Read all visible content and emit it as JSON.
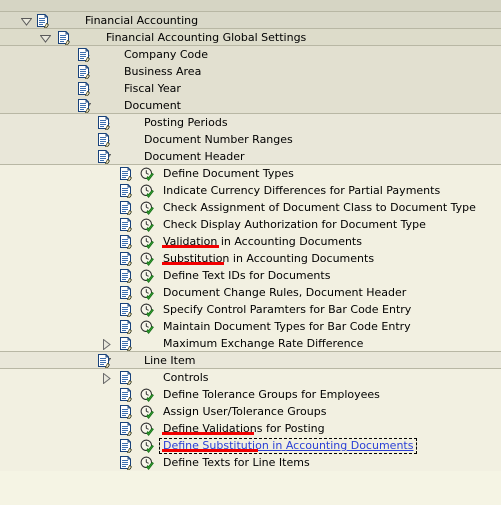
{
  "app": {
    "name": "SAP Implementation Guide (IMG) tree",
    "colors": {
      "background": "#f5f4e4",
      "row_line": "#b8b7a4",
      "link_text": "#2a3fd6",
      "marker_red": "#f20000",
      "text": "#000000"
    }
  },
  "tree": {
    "rows": [
      {
        "id": "financial-accounting",
        "label": "Financial Accounting",
        "level": 0,
        "node_type": "folder",
        "state": "expanded",
        "twisty": "chevron-down-icon",
        "icon": "img-node-icon",
        "has_activity_icon": false,
        "marked": false,
        "focused": false,
        "link": false
      },
      {
        "id": "financial-accounting-global-settings",
        "label": "Financial Accounting Global Settings",
        "level": 1,
        "node_type": "folder",
        "state": "expanded",
        "twisty": "chevron-down-icon",
        "icon": "img-node-icon",
        "has_activity_icon": false,
        "marked": false,
        "focused": false,
        "link": false
      },
      {
        "id": "company-code",
        "label": "Company Code",
        "level": 2,
        "node_type": "folder",
        "state": "collapsed",
        "twisty": "chevron-right-icon",
        "icon": "img-node-icon",
        "has_activity_icon": false,
        "marked": false,
        "focused": false,
        "link": false
      },
      {
        "id": "business-area",
        "label": "Business Area",
        "level": 2,
        "node_type": "folder",
        "state": "collapsed",
        "twisty": "chevron-right-icon",
        "icon": "img-node-icon",
        "has_activity_icon": false,
        "marked": false,
        "focused": false,
        "link": false
      },
      {
        "id": "fiscal-year",
        "label": "Fiscal Year",
        "level": 2,
        "node_type": "folder",
        "state": "collapsed",
        "twisty": "chevron-right-icon",
        "icon": "img-node-icon",
        "has_activity_icon": false,
        "marked": false,
        "focused": false,
        "link": false
      },
      {
        "id": "document",
        "label": "Document",
        "level": 2,
        "node_type": "folder",
        "state": "expanded",
        "twisty": "chevron-down-icon",
        "icon": "img-node-icon",
        "has_activity_icon": false,
        "marked": false,
        "focused": false,
        "link": false
      },
      {
        "id": "posting-periods",
        "label": "Posting Periods",
        "level": 3,
        "node_type": "folder",
        "state": "collapsed",
        "twisty": "chevron-right-icon",
        "icon": "img-node-icon",
        "has_activity_icon": false,
        "marked": false,
        "focused": false,
        "link": false
      },
      {
        "id": "document-number-ranges",
        "label": "Document Number Ranges",
        "level": 3,
        "node_type": "folder",
        "state": "collapsed",
        "twisty": "chevron-right-icon",
        "icon": "img-node-icon",
        "has_activity_icon": false,
        "marked": false,
        "focused": false,
        "link": false
      },
      {
        "id": "document-header",
        "label": "Document Header",
        "level": 3,
        "node_type": "folder",
        "state": "expanded",
        "twisty": "chevron-down-icon",
        "icon": "img-node-icon",
        "has_activity_icon": false,
        "marked": false,
        "focused": false,
        "link": false
      },
      {
        "id": "define-document-types",
        "label": "Define Document Types",
        "level": 4,
        "node_type": "activity",
        "state": "leaf",
        "twisty": "none",
        "icon": "img-node-icon",
        "has_activity_icon": true,
        "marked": false,
        "focused": false,
        "link": false
      },
      {
        "id": "indicate-currency-differences-for-partial-payments",
        "label": "Indicate Currency Differences for Partial Payments",
        "level": 4,
        "node_type": "activity",
        "state": "leaf",
        "twisty": "none",
        "icon": "img-node-icon",
        "has_activity_icon": true,
        "marked": false,
        "focused": false,
        "link": false
      },
      {
        "id": "check-assignment-of-document-class-to-document-type",
        "label": "Check Assignment of Document Class to Document Type",
        "level": 4,
        "node_type": "activity",
        "state": "leaf",
        "twisty": "none",
        "icon": "img-node-icon",
        "has_activity_icon": true,
        "marked": false,
        "focused": false,
        "link": false
      },
      {
        "id": "check-display-authorization-for-document-type",
        "label": "Check Display Authorization for Document Type",
        "level": 4,
        "node_type": "activity",
        "state": "leaf",
        "twisty": "none",
        "icon": "img-node-icon",
        "has_activity_icon": true,
        "marked": false,
        "focused": false,
        "link": false
      },
      {
        "id": "validation-in-accounting-documents",
        "label": "Validation in Accounting Documents",
        "level": 4,
        "node_type": "activity",
        "state": "leaf",
        "twisty": "none",
        "icon": "img-node-icon",
        "has_activity_icon": true,
        "marked": true,
        "marker_width": 57,
        "focused": false,
        "link": false
      },
      {
        "id": "substitution-in-accounting-documents",
        "label": "Substitution in Accounting Documents",
        "level": 4,
        "node_type": "activity",
        "state": "leaf",
        "twisty": "none",
        "icon": "img-node-icon",
        "has_activity_icon": true,
        "marked": true,
        "marker_width": 62,
        "focused": false,
        "link": false
      },
      {
        "id": "define-text-ids-for-documents",
        "label": "Define Text IDs for Documents",
        "level": 4,
        "node_type": "activity",
        "state": "leaf",
        "twisty": "none",
        "icon": "img-node-icon",
        "has_activity_icon": true,
        "marked": false,
        "focused": false,
        "link": false
      },
      {
        "id": "document-change-rules-document-header",
        "label": "Document Change Rules, Document Header",
        "level": 4,
        "node_type": "activity",
        "state": "leaf",
        "twisty": "none",
        "icon": "img-node-icon",
        "has_activity_icon": true,
        "marked": false,
        "focused": false,
        "link": false
      },
      {
        "id": "specify-control-paramters-for-bar-code-entry",
        "label": "Specify Control Paramters for Bar Code Entry",
        "level": 4,
        "node_type": "activity",
        "state": "leaf",
        "twisty": "none",
        "icon": "img-node-icon",
        "has_activity_icon": true,
        "marked": false,
        "focused": false,
        "link": false
      },
      {
        "id": "maintain-document-types-for-bar-code-entry",
        "label": "Maintain Document Types for Bar Code Entry",
        "level": 4,
        "node_type": "activity",
        "state": "leaf",
        "twisty": "none",
        "icon": "img-node-icon",
        "has_activity_icon": true,
        "marked": false,
        "focused": false,
        "link": false
      },
      {
        "id": "maximum-exchange-rate-difference",
        "label": "Maximum Exchange Rate Difference",
        "level": 4,
        "node_type": "folder",
        "state": "collapsed",
        "twisty": "chevron-right-icon",
        "icon": "img-node-icon",
        "has_activity_icon": false,
        "marked": false,
        "focused": false,
        "link": false
      },
      {
        "id": "line-item",
        "label": "Line Item",
        "level": 3,
        "node_type": "folder",
        "state": "expanded",
        "twisty": "chevron-down-icon",
        "icon": "img-node-icon",
        "has_activity_icon": false,
        "marked": false,
        "focused": false,
        "link": false
      },
      {
        "id": "controls",
        "label": "Controls",
        "level": 4,
        "node_type": "folder",
        "state": "collapsed",
        "twisty": "chevron-right-icon",
        "icon": "img-node-icon",
        "has_activity_icon": false,
        "marked": false,
        "focused": false,
        "link": false
      },
      {
        "id": "define-tolerance-groups-for-employees",
        "label": "Define Tolerance Groups for Employees",
        "level": 4,
        "node_type": "activity",
        "state": "leaf",
        "twisty": "none",
        "icon": "img-node-icon",
        "has_activity_icon": true,
        "marked": false,
        "focused": false,
        "link": false
      },
      {
        "id": "assign-user-tolerance-groups",
        "label": "Assign User/Tolerance Groups",
        "level": 4,
        "node_type": "activity",
        "state": "leaf",
        "twisty": "none",
        "icon": "img-node-icon",
        "has_activity_icon": true,
        "marked": false,
        "focused": false,
        "link": false
      },
      {
        "id": "define-validations-for-posting",
        "label": "Define Validations for Posting",
        "level": 4,
        "node_type": "activity",
        "state": "leaf",
        "twisty": "none",
        "icon": "img-node-icon",
        "has_activity_icon": true,
        "marked": true,
        "marker_width": 92,
        "focused": false,
        "link": false
      },
      {
        "id": "define-substitution-in-accounting-documents",
        "label": "Define Substitution in Accounting Documents",
        "level": 4,
        "node_type": "activity",
        "state": "leaf",
        "twisty": "none",
        "icon": "img-node-icon",
        "has_activity_icon": true,
        "marked": true,
        "marker_width": 96,
        "focused": true,
        "link": true
      },
      {
        "id": "define-texts-for-line-items",
        "label": "Define Texts for Line Items",
        "level": 4,
        "node_type": "activity",
        "state": "leaf",
        "twisty": "none",
        "icon": "img-node-icon",
        "has_activity_icon": true,
        "marked": false,
        "focused": false,
        "link": false
      }
    ]
  }
}
